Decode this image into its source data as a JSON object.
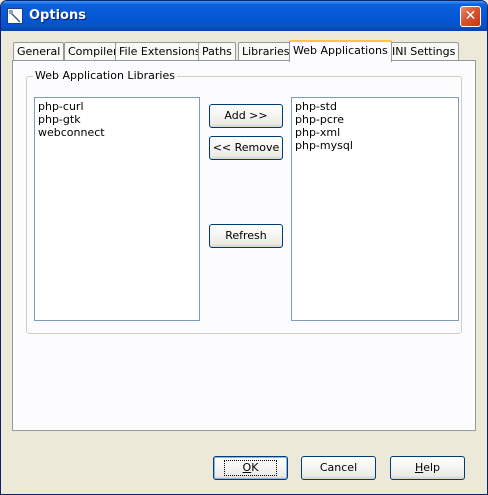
{
  "window": {
    "title": "Options",
    "close_glyph": "✕"
  },
  "tabs": [
    {
      "label": "General",
      "active": false
    },
    {
      "label": "Compiler",
      "active": false
    },
    {
      "label": "File Extensions",
      "active": false
    },
    {
      "label": "Paths",
      "active": false
    },
    {
      "label": "Libraries",
      "active": false
    },
    {
      "label": "Web Applications",
      "active": true
    },
    {
      "label": "INI Settings",
      "active": false
    }
  ],
  "group": {
    "label": "Web Application Libraries"
  },
  "available_list": [
    "php-curl",
    "php-gtk",
    "webconnect"
  ],
  "selected_list": [
    "php-std",
    "php-pcre",
    "php-xml",
    "php-mysql"
  ],
  "buttons": {
    "add": "Add >>",
    "remove": "<< Remove",
    "refresh": "Refresh"
  },
  "footer": {
    "ok": {
      "mnemonic": "O",
      "rest": "K"
    },
    "cancel": {
      "mnemonic": "",
      "rest": "Cancel"
    },
    "help": {
      "mnemonic": "H",
      "rest": "elp"
    }
  },
  "icons": {
    "app": "options-app-icon",
    "close": "close-icon"
  }
}
